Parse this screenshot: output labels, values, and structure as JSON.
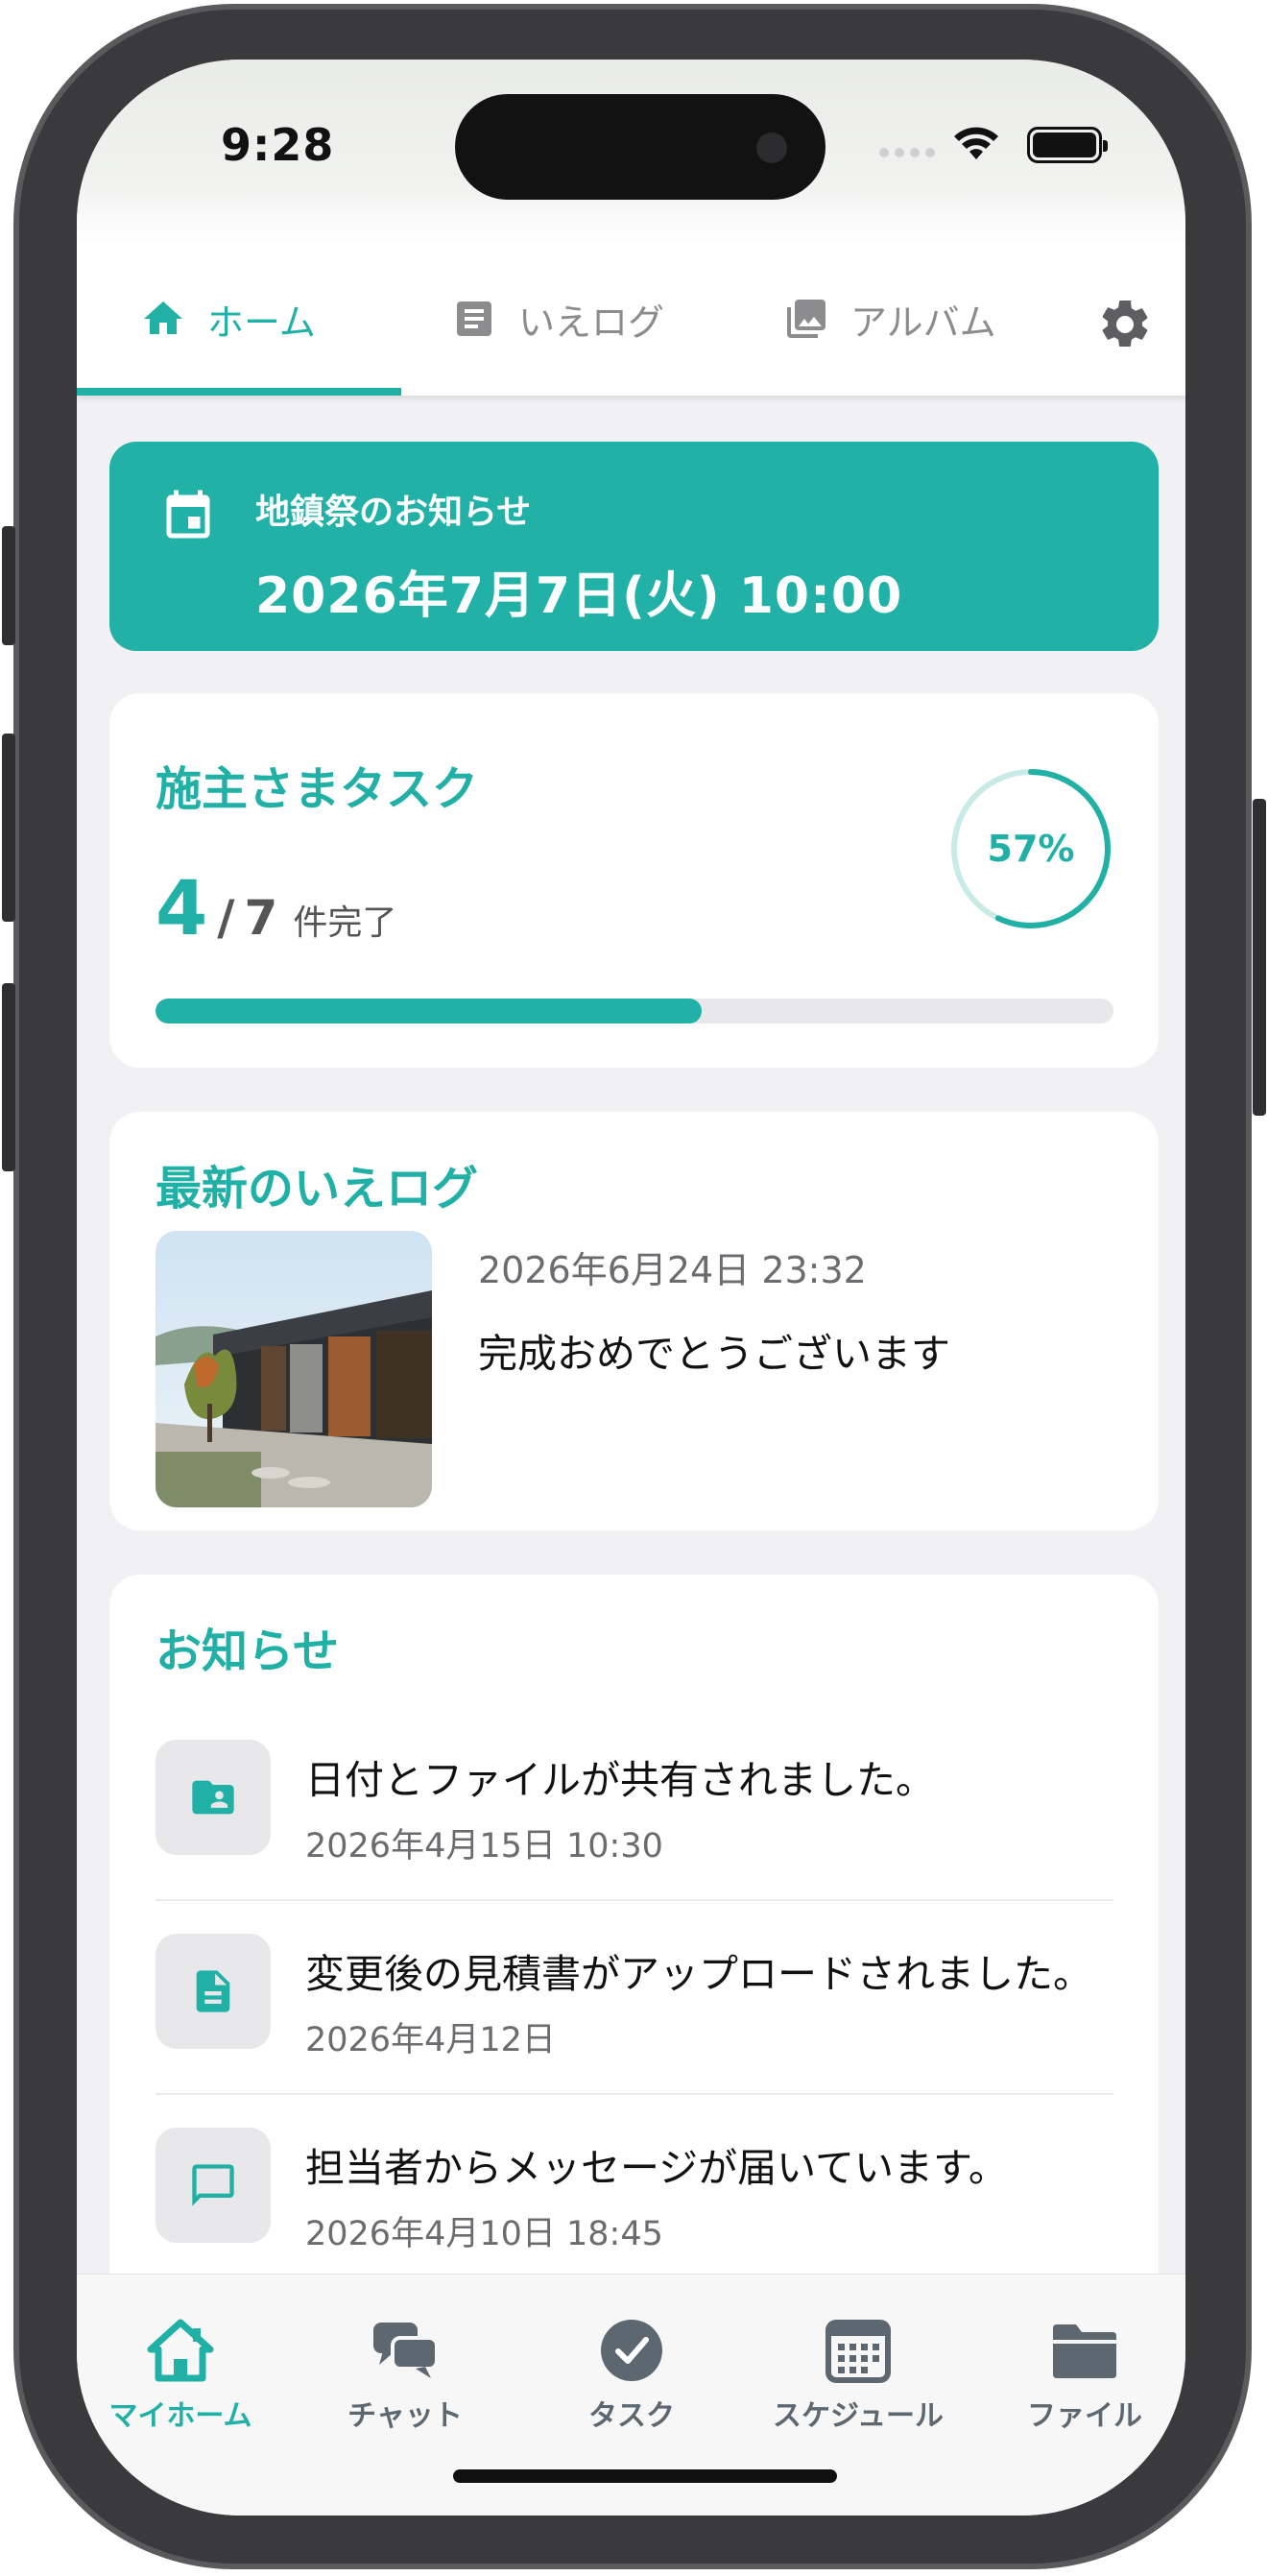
{
  "status": {
    "time": "9:28"
  },
  "tabs": [
    {
      "label": "ホーム",
      "icon": "home-icon",
      "active": true
    },
    {
      "label": "いえログ",
      "icon": "article-icon",
      "active": false
    },
    {
      "label": "アルバム",
      "icon": "photo-library-icon",
      "active": false
    }
  ],
  "settings": {
    "icon": "gear-icon"
  },
  "notice": {
    "icon": "calendar-icon",
    "label": "地鎮祭のお知らせ",
    "date": "2026年7月7日(火) 10:00"
  },
  "tasks": {
    "heading": "施主さまタスク",
    "done": "4",
    "slash": "/",
    "total": "7",
    "unit": "件完了",
    "percent_label": "57%",
    "progress": 0.57
  },
  "ielog": {
    "heading": "最新のいえログ",
    "date": "2026年6月24日 23:32",
    "text": "完成おめでとうございます"
  },
  "news": {
    "heading": "お知らせ",
    "items": [
      {
        "icon": "shared-folder-icon",
        "title": "日付とファイルが共有されました。",
        "when": "2026年4月15日 10:30"
      },
      {
        "icon": "document-icon",
        "title": "変更後の見積書がアップロードされました。",
        "when": "2026年4月12日"
      },
      {
        "icon": "chat-bubble-icon",
        "title": "担当者からメッセージが届いています。",
        "when": "2026年4月10日 18:45"
      }
    ]
  },
  "bottom_nav": [
    {
      "label": "マイホーム",
      "icon": "house-icon",
      "active": true
    },
    {
      "label": "チャット",
      "icon": "chat-icon",
      "active": false
    },
    {
      "label": "タスク",
      "icon": "check-circle-icon",
      "active": false
    },
    {
      "label": "スケジュール",
      "icon": "calendar-grid-icon",
      "active": false
    },
    {
      "label": "ファイル",
      "icon": "folder-icon",
      "active": false
    }
  ],
  "colors": {
    "accent": "#21b0a6",
    "background": "#f1f1f3",
    "inactive": "#8c8c8f"
  }
}
